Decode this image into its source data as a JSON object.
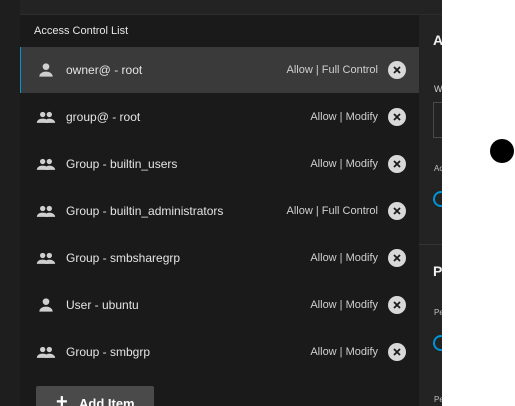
{
  "acl": {
    "title": "Access Control List",
    "items": [
      {
        "name": "owner@ - root",
        "permission": "Allow | Full Control",
        "icon": "person-icon"
      },
      {
        "name": "group@ - root",
        "permission": "Allow | Modify",
        "icon": "people-icon"
      },
      {
        "name": "Group - builtin_users",
        "permission": "Allow | Modify",
        "icon": "people-icon"
      },
      {
        "name": "Group - builtin_administrators",
        "permission": "Allow | Full Control",
        "icon": "people-icon"
      },
      {
        "name": "Group - smbsharegrp",
        "permission": "Allow | Modify",
        "icon": "people-icon"
      },
      {
        "name": "User - ubuntu",
        "permission": "Allow | Modify",
        "icon": "person-icon"
      },
      {
        "name": "Group - smbgrp",
        "permission": "Allow | Modify",
        "icon": "people-icon"
      }
    ],
    "add_button": "Add Item"
  },
  "side_panel": {
    "heading1": "A",
    "label1": "W",
    "label2": "Ac",
    "heading2": "P",
    "label3": "Pe",
    "label4": "Pe"
  },
  "colors": {
    "accent": "#0095d5",
    "panel_bg": "#1a1a1a",
    "selected_bg": "#3a3a3a"
  }
}
